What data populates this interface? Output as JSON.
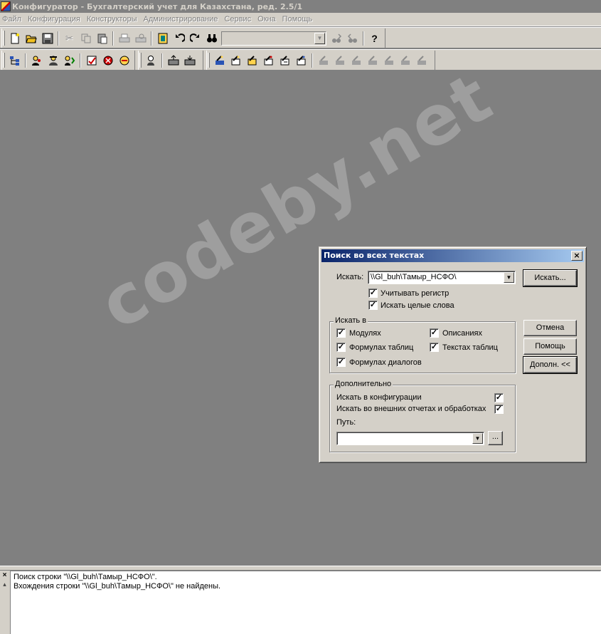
{
  "window": {
    "title": "Конфигуратор - Бухгалтерский учет для Казахстана, ред. 2.5/1"
  },
  "menu": [
    "Файл",
    "Конфигурация",
    "Конструкторы",
    "Администрирование",
    "Сервис",
    "Окна",
    "Помощь"
  ],
  "toolbar": {
    "help_glyph": "?",
    "browse_glyph": "..."
  },
  "dialog": {
    "title": "Поиск во всех текстах",
    "search_label": "Искать:",
    "search_value": "\\\\Gl_buh\\Тамыр_НСФО\\",
    "case_label": "Учитывать регистр",
    "case_checked": true,
    "whole_words_label": "Искать целые слова",
    "whole_words_checked": true,
    "search_in_group": "Искать в",
    "modules_label": "Модулях",
    "descriptions_label": "Описаниях",
    "table_formulas_label": "Формулах таблиц",
    "table_texts_label": "Текстах таблиц",
    "dialog_formulas_label": "Формулах диалогов",
    "additional_group": "Дополнительно",
    "in_config_label": "Искать в конфигурации",
    "in_external_label": "Искать во внешних отчетах и обработках",
    "path_label": "Путь:",
    "path_value": "",
    "buttons": {
      "search": "Искать...",
      "cancel": "Отмена",
      "help": "Помощь",
      "more": "Дополн. <<"
    },
    "check_mark": "✓"
  },
  "messages": [
    "Поиск строки \"\\\\Gl_buh\\Тамыр_НСФО\\\".",
    "Вхождения  строки \"\\\\Gl_buh\\Тамыр_НСФО\\\" не найдены."
  ],
  "watermark": "codeby.net"
}
